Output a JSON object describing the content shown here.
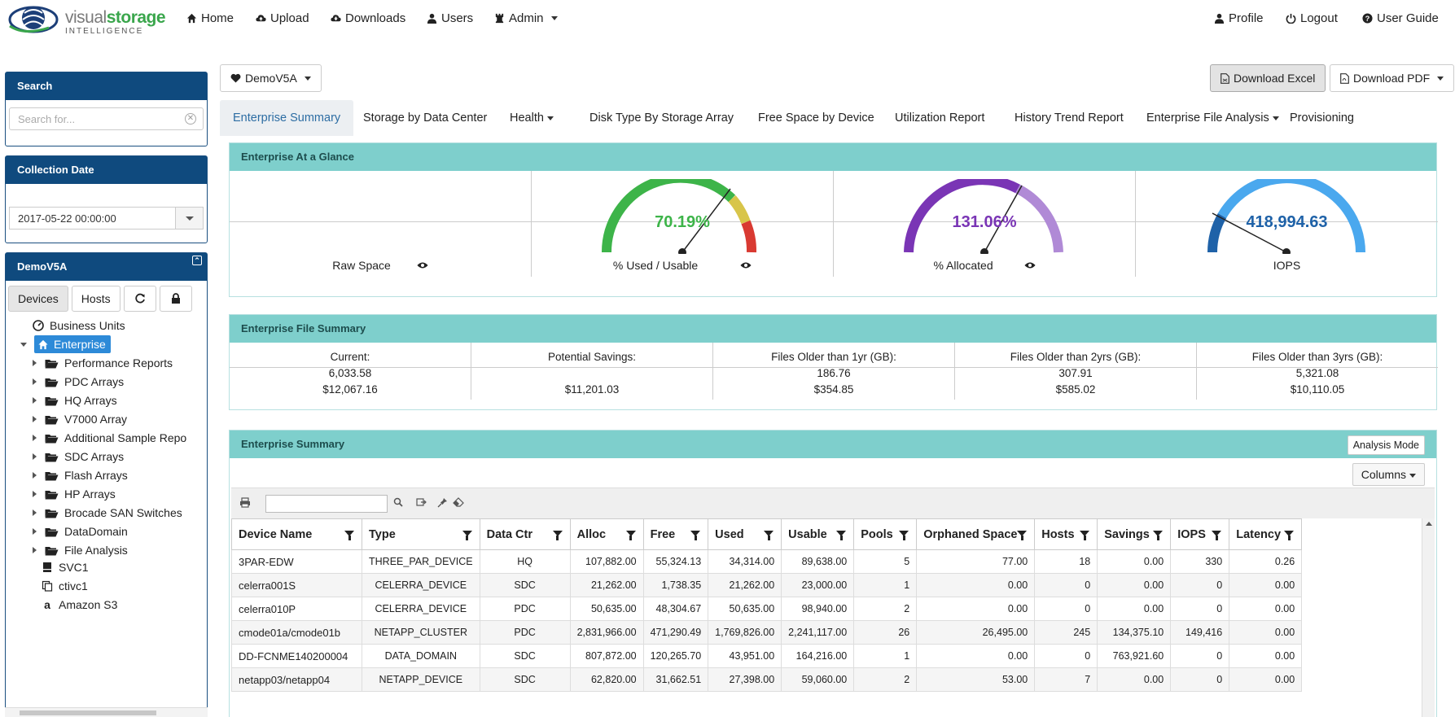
{
  "brand": {
    "visual": "visual",
    "storage": "storage",
    "sub": "INTELLIGENCE"
  },
  "nav": {
    "home": "Home",
    "upload": "Upload",
    "downloads": "Downloads",
    "users": "Users",
    "admin": "Admin",
    "profile": "Profile",
    "logout": "Logout",
    "guide": "User Guide"
  },
  "sidebar": {
    "search_title": "Search",
    "search_placeholder": "Search for...",
    "date_title": "Collection Date",
    "date_value": "2017-05-22 00:00:00",
    "tree_title": "DemoV5A",
    "tab_devices": "Devices",
    "tab_hosts": "Hosts",
    "tree": [
      "Business Units",
      "Enterprise",
      "Performance Reports",
      "PDC Arrays",
      "HQ Arrays",
      "V7000 Array",
      "Additional Sample Repo",
      "SDC Arrays",
      "Flash Arrays",
      "HP Arrays",
      "Brocade SAN Switches",
      "DataDomain",
      "File Analysis",
      "SVC1",
      "ctivc1",
      "Amazon S3"
    ]
  },
  "toolbar": {
    "tenant": "DemoV5A",
    "download_excel": "Download Excel",
    "download_pdf": "Download PDF"
  },
  "tabs": [
    "Enterprise Summary",
    "Storage by Data Center",
    "Health",
    "Disk Type By Storage Array",
    "Free Space by Device",
    "Utilization Report",
    "History Trend Report",
    "Enterprise File Analysis",
    "Provisioning"
  ],
  "glance": {
    "title": "Enterprise At a Glance",
    "raw_space": "Raw Space",
    "used_label": "% Used / Usable",
    "used_value": "70.19%",
    "alloc_label": "% Allocated",
    "alloc_value": "131.06%",
    "iops_label": "IOPS",
    "iops_value": "418,994.63",
    "colors": {
      "green": "#3db449",
      "yellow": "#d8c54a",
      "red": "#d93a32",
      "purple": "#7a35b5",
      "lilac": "#b08ad6",
      "blue": "#4aa8ee",
      "darkblue": "#1f62a8"
    }
  },
  "file_summary": {
    "title": "Enterprise File Summary",
    "cols": [
      {
        "head": "Current:",
        "l1": "6,033.58",
        "l2": "$12,067.16"
      },
      {
        "head": "Potential Savings:",
        "l1": "",
        "l2": "$11,201.03"
      },
      {
        "head": "Files Older than 1yr (GB):",
        "l1": "186.76",
        "l2": "$354.85"
      },
      {
        "head": "Files Older than 2yrs (GB):",
        "l1": "307.91",
        "l2": "$585.02"
      },
      {
        "head": "Files Older than 3yrs (GB):",
        "l1": "5,321.08",
        "l2": "$10,110.05"
      }
    ]
  },
  "summary": {
    "title": "Enterprise Summary",
    "analysis_mode": "Analysis Mode",
    "columns": "Columns",
    "headers": [
      "Device Name",
      "Type",
      "Data Ctr",
      "Alloc",
      "Free",
      "Used",
      "Usable",
      "Pools",
      "Orphaned Space",
      "Hosts",
      "Savings",
      "IOPS",
      "Latency"
    ],
    "rows": [
      [
        "3PAR-EDW",
        "THREE_PAR_DEVICE",
        "HQ",
        "107,882.00",
        "55,324.13",
        "34,314.00",
        "89,638.00",
        "5",
        "77.00",
        "18",
        "0.00",
        "330",
        "0.26"
      ],
      [
        "celerra001S",
        "CELERRA_DEVICE",
        "SDC",
        "21,262.00",
        "1,738.35",
        "21,262.00",
        "23,000.00",
        "1",
        "0.00",
        "0",
        "0.00",
        "0",
        "0.00"
      ],
      [
        "celerra010P",
        "CELERRA_DEVICE",
        "PDC",
        "50,635.00",
        "48,304.67",
        "50,635.00",
        "98,940.00",
        "2",
        "0.00",
        "0",
        "0.00",
        "0",
        "0.00"
      ],
      [
        "cmode01a/cmode01b",
        "NETAPP_CLUSTER",
        "PDC",
        "2,831,966.00",
        "471,290.49",
        "1,769,826.00",
        "2,241,117.00",
        "26",
        "26,495.00",
        "245",
        "134,375.10",
        "149,416",
        "0.00"
      ],
      [
        "DD-FCNME140200004",
        "DATA_DOMAIN",
        "SDC",
        "807,872.00",
        "120,265.70",
        "43,951.00",
        "164,216.00",
        "1",
        "0.00",
        "0",
        "763,921.60",
        "0",
        "0.00"
      ],
      [
        "netapp03/netapp04",
        "NETAPP_DEVICE",
        "SDC",
        "62,820.00",
        "31,662.51",
        "27,398.00",
        "59,060.00",
        "2",
        "53.00",
        "7",
        "0.00",
        "0",
        "0.00"
      ]
    ]
  }
}
